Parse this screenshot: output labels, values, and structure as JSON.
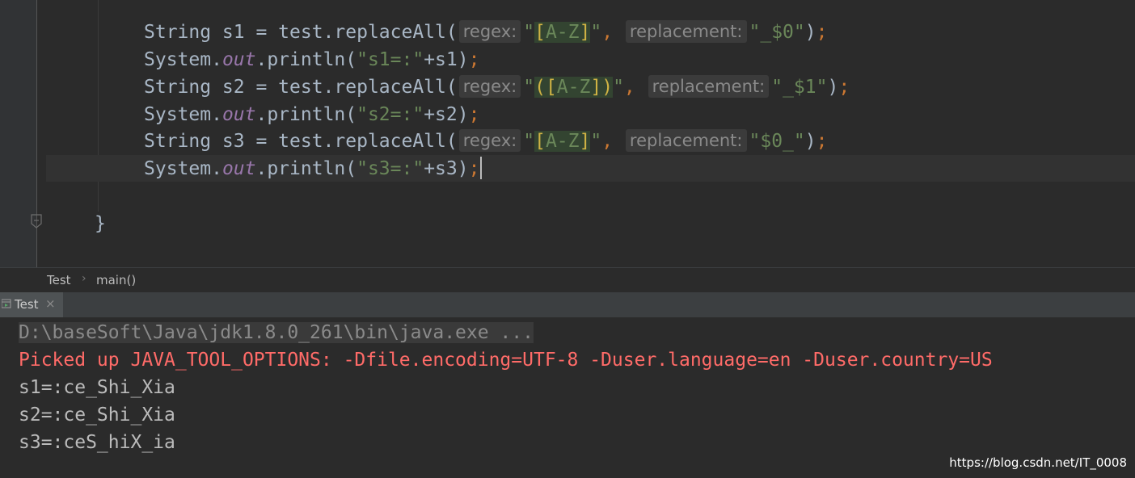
{
  "editor": {
    "lines": [
      {
        "id": "l1",
        "parts": [
          {
            "t": "String s1 = test.replaceAll(",
            "c": "plain"
          },
          {
            "t": "regex:",
            "c": "hint"
          },
          {
            "t": "\"",
            "c": "str"
          },
          {
            "t": "[",
            "c": "regex-hl bracket"
          },
          {
            "t": "A-Z",
            "c": "regex-hl"
          },
          {
            "t": "]",
            "c": "regex-hl bracket"
          },
          {
            "t": "\"",
            "c": "str"
          },
          {
            "t": ", ",
            "c": "kw"
          },
          {
            "t": "replacement:",
            "c": "hint"
          },
          {
            "t": "\"_$0\"",
            "c": "str"
          },
          {
            "t": ")",
            "c": "plain"
          },
          {
            "t": ";",
            "c": "kw"
          }
        ]
      },
      {
        "id": "l2",
        "parts": [
          {
            "t": "System.",
            "c": "plain"
          },
          {
            "t": "out",
            "c": "fld"
          },
          {
            "t": ".println(",
            "c": "plain"
          },
          {
            "t": "\"s1=:\"",
            "c": "str"
          },
          {
            "t": "+s1)",
            "c": "plain"
          },
          {
            "t": ";",
            "c": "kw"
          }
        ]
      },
      {
        "id": "l3",
        "parts": [
          {
            "t": "String s2 = test.replaceAll(",
            "c": "plain"
          },
          {
            "t": "regex:",
            "c": "hint"
          },
          {
            "t": "\"",
            "c": "str"
          },
          {
            "t": "(",
            "c": "regex-hl bracket"
          },
          {
            "t": "[",
            "c": "regex-hl bracket"
          },
          {
            "t": "A-Z",
            "c": "regex-hl"
          },
          {
            "t": "]",
            "c": "regex-hl bracket"
          },
          {
            "t": ")",
            "c": "regex-hl bracket"
          },
          {
            "t": "\"",
            "c": "str"
          },
          {
            "t": ", ",
            "c": "kw"
          },
          {
            "t": "replacement:",
            "c": "hint"
          },
          {
            "t": "\"_$1\"",
            "c": "str"
          },
          {
            "t": ")",
            "c": "plain"
          },
          {
            "t": ";",
            "c": "kw"
          }
        ]
      },
      {
        "id": "l4",
        "parts": [
          {
            "t": "System.",
            "c": "plain"
          },
          {
            "t": "out",
            "c": "fld"
          },
          {
            "t": ".println(",
            "c": "plain"
          },
          {
            "t": "\"s2=:\"",
            "c": "str"
          },
          {
            "t": "+s2)",
            "c": "plain"
          },
          {
            "t": ";",
            "c": "kw"
          }
        ]
      },
      {
        "id": "l5",
        "parts": [
          {
            "t": "String s3 = test.replaceAll(",
            "c": "plain"
          },
          {
            "t": "regex:",
            "c": "hint"
          },
          {
            "t": "\"",
            "c": "str"
          },
          {
            "t": "[",
            "c": "regex-hl bracket"
          },
          {
            "t": "A-Z",
            "c": "regex-hl"
          },
          {
            "t": "]",
            "c": "regex-hl bracket"
          },
          {
            "t": "\"",
            "c": "str"
          },
          {
            "t": ", ",
            "c": "kw"
          },
          {
            "t": "replacement:",
            "c": "hint"
          },
          {
            "t": "\"$0_\"",
            "c": "str"
          },
          {
            "t": ")",
            "c": "plain"
          },
          {
            "t": ";",
            "c": "kw"
          }
        ]
      },
      {
        "id": "l6",
        "caret": true,
        "parts": [
          {
            "t": "System.",
            "c": "plain"
          },
          {
            "t": "out",
            "c": "fld"
          },
          {
            "t": ".println(",
            "c": "plain"
          },
          {
            "t": "\"s3=:\"",
            "c": "str"
          },
          {
            "t": "+s3)",
            "c": "plain"
          },
          {
            "t": ";",
            "c": "kw"
          }
        ]
      }
    ],
    "closing_brace": "}"
  },
  "breadcrumb": {
    "class_name": "Test",
    "separator": "›",
    "method_name": "main()"
  },
  "run_window": {
    "tab_label": "Test",
    "tab_close": "×"
  },
  "console": {
    "command": "D:\\baseSoft\\Java\\jdk1.8.0_261\\bin\\java.exe ...",
    "stderr_line": "Picked up JAVA_TOOL_OPTIONS: -Dfile.encoding=UTF-8 -Duser.language=en -Duser.country=US",
    "output": [
      "s1=:ce_Shi_Xia",
      "s2=:ce_Shi_Xia",
      "s3=:ceS_hiX_ia"
    ]
  },
  "watermark": "https://blog.csdn.net/IT_0008",
  "colors": {
    "editor_bg": "#2b2b2b",
    "plain": "#a9b7c6",
    "keyword": "#cc7832",
    "string": "#6a8759",
    "field": "#9876aa",
    "error": "#ff6b68"
  }
}
